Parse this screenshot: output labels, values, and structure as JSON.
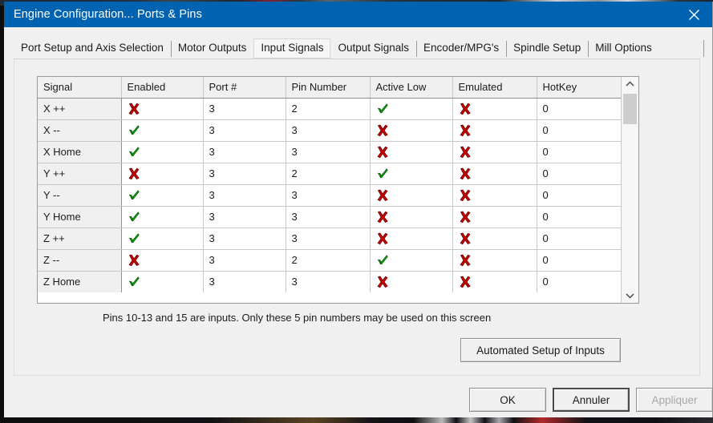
{
  "window": {
    "title": "Engine Configuration... Ports & Pins",
    "close_icon": "close-icon",
    "titlebar_color": "#0063b1"
  },
  "tabs": [
    {
      "label": "Port Setup and Axis Selection",
      "selected": false
    },
    {
      "label": "Motor Outputs",
      "selected": false
    },
    {
      "label": "Input Signals",
      "selected": true
    },
    {
      "label": "Output Signals",
      "selected": false
    },
    {
      "label": "Encoder/MPG's",
      "selected": false
    },
    {
      "label": "Spindle Setup",
      "selected": false
    },
    {
      "label": "Mill Options",
      "selected": false
    }
  ],
  "grid": {
    "columns": [
      "Signal",
      "Enabled",
      "Port #",
      "Pin Number",
      "Active Low",
      "Emulated",
      "HotKey"
    ],
    "rows": [
      {
        "signal": "X ++",
        "enabled": "cross",
        "port": "3",
        "pin": "2",
        "active_low": "check",
        "emulated": "cross",
        "hotkey": "0"
      },
      {
        "signal": "X --",
        "enabled": "check",
        "port": "3",
        "pin": "3",
        "active_low": "cross",
        "emulated": "cross",
        "hotkey": "0"
      },
      {
        "signal": "X Home",
        "enabled": "check",
        "port": "3",
        "pin": "3",
        "active_low": "cross",
        "emulated": "cross",
        "hotkey": "0"
      },
      {
        "signal": "Y ++",
        "enabled": "cross",
        "port": "3",
        "pin": "2",
        "active_low": "check",
        "emulated": "cross",
        "hotkey": "0"
      },
      {
        "signal": "Y --",
        "enabled": "check",
        "port": "3",
        "pin": "3",
        "active_low": "cross",
        "emulated": "cross",
        "hotkey": "0"
      },
      {
        "signal": "Y Home",
        "enabled": "check",
        "port": "3",
        "pin": "3",
        "active_low": "cross",
        "emulated": "cross",
        "hotkey": "0"
      },
      {
        "signal": "Z ++",
        "enabled": "check",
        "port": "3",
        "pin": "3",
        "active_low": "cross",
        "emulated": "cross",
        "hotkey": "0"
      },
      {
        "signal": "Z --",
        "enabled": "cross",
        "port": "3",
        "pin": "2",
        "active_low": "check",
        "emulated": "cross",
        "hotkey": "0"
      },
      {
        "signal": "Z Home",
        "enabled": "check",
        "port": "3",
        "pin": "3",
        "active_low": "cross",
        "emulated": "cross",
        "hotkey": "0"
      }
    ],
    "mark_colors": {
      "check": "#00b000",
      "cross": "#cc0000"
    },
    "scrollbar": {
      "up_icon": "chevron-up-icon",
      "down_icon": "chevron-down-icon"
    }
  },
  "note": "Pins 10-13 and 15 are inputs. Only these 5 pin numbers may be used on this screen",
  "buttons": {
    "automated_setup": "Automated Setup of Inputs",
    "ok": "OK",
    "cancel": "Annuler",
    "apply": "Appliquer"
  }
}
